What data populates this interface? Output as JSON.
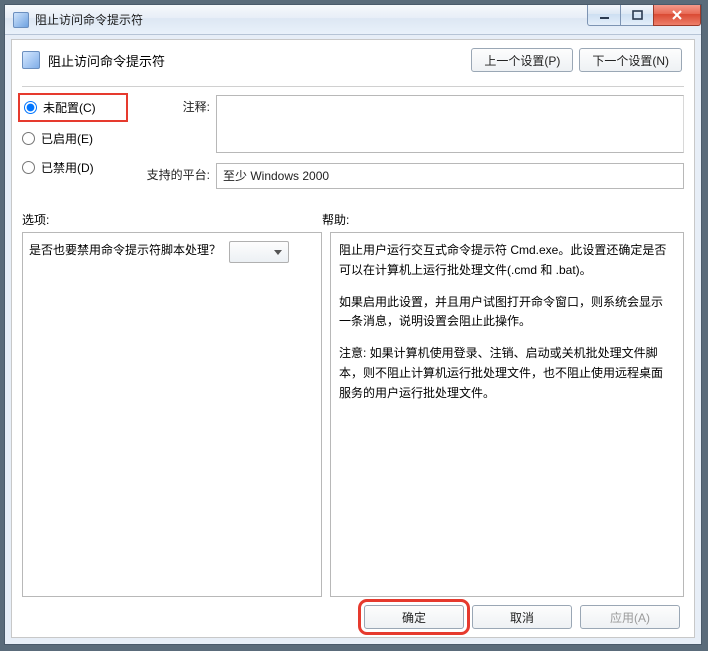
{
  "window": {
    "title": "阻止访问命令提示符"
  },
  "header": {
    "title": "阻止访问命令提示符",
    "prev": "上一个设置(P)",
    "next": "下一个设置(N)"
  },
  "radios": {
    "unconfigured": "未配置(C)",
    "enabled": "已启用(E)",
    "disabled": "已禁用(D)"
  },
  "fields": {
    "comment_label": "注释:",
    "platform_label": "支持的平台:",
    "platform_value": "至少 Windows 2000"
  },
  "labels": {
    "options": "选项:",
    "help": "帮助:"
  },
  "options": {
    "question": "是否也要禁用命令提示符脚本处理？"
  },
  "help": {
    "p1": "阻止用户运行交互式命令提示符 Cmd.exe。此设置还确定是否可以在计算机上运行批处理文件(.cmd 和 .bat)。",
    "p2": "如果启用此设置，并且用户试图打开命令窗口，则系统会显示一条消息，说明设置会阻止此操作。",
    "p3": "注意: 如果计算机使用登录、注销、启动或关机批处理文件脚本，则不阻止计算机运行批处理文件，也不阻止使用远程桌面服务的用户运行批处理文件。"
  },
  "footer": {
    "ok": "确定",
    "cancel": "取消",
    "apply": "应用(A)"
  }
}
